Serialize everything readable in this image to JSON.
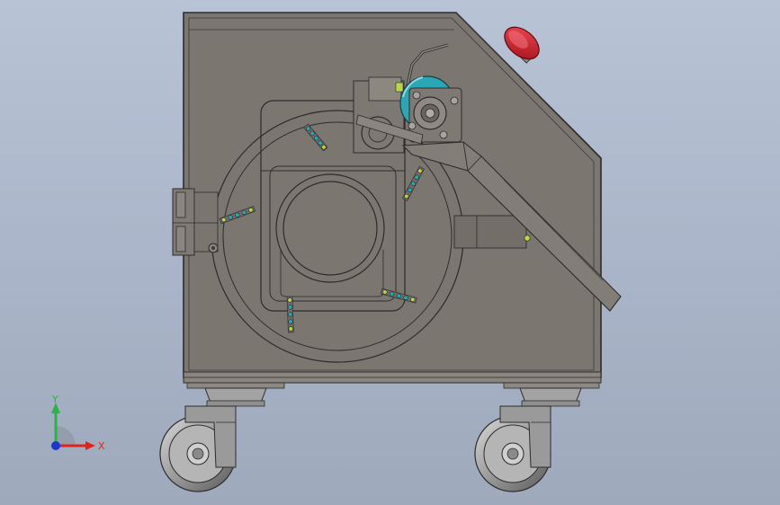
{
  "viewport": {
    "background_top": "#b8c3d6",
    "background_bottom": "#9fa9bc",
    "body_fill": "#7b7670",
    "edge_color": "#2c2c2c",
    "accent_teal": "#2aa6b5",
    "estop_red": "#d81e2b"
  },
  "triad": {
    "y_label": "Y",
    "x_label": "X",
    "y_color": "#2bb34a",
    "x_color": "#e2231a",
    "z_color": "#1b35d6"
  }
}
